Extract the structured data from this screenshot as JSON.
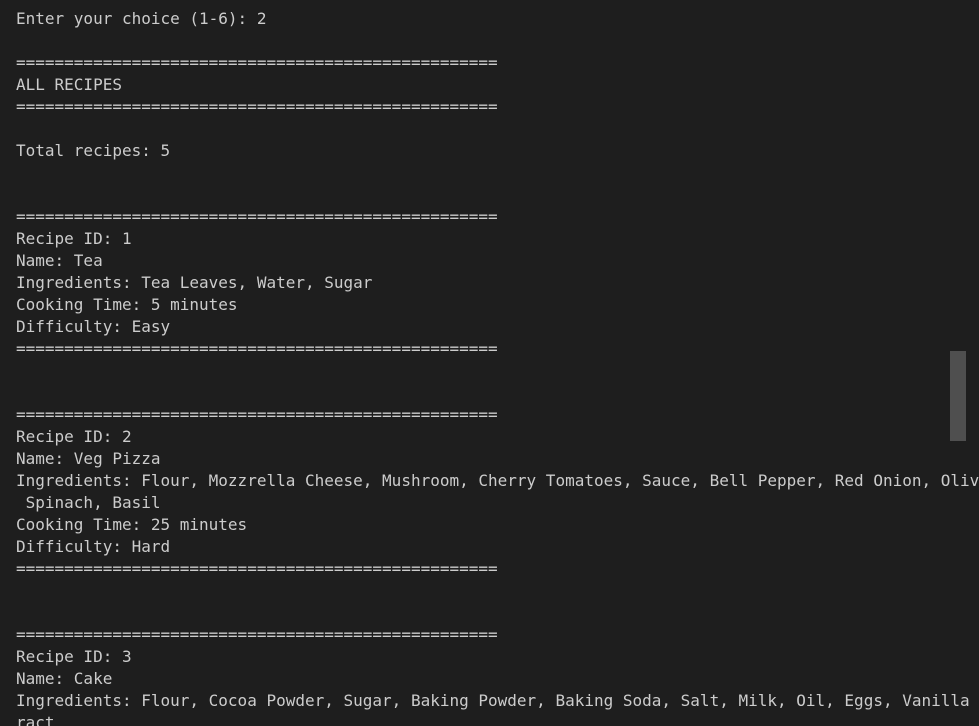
{
  "terminal": {
    "lines": [
      "Enter your choice (1-6): 2",
      "",
      "==================================================",
      "ALL RECIPES",
      "==================================================",
      "",
      "Total recipes: 5",
      "",
      "",
      "==================================================",
      "Recipe ID: 1",
      "Name: Tea",
      "Ingredients: Tea Leaves, Water, Sugar",
      "Cooking Time: 5 minutes",
      "Difficulty: Easy",
      "==================================================",
      "",
      "",
      "==================================================",
      "Recipe ID: 2",
      "Name: Veg Pizza",
      "Ingredients: Flour, Mozzrella Cheese, Mushroom, Cherry Tomatoes, Sauce, Bell Pepper, Red Onion, Olives,",
      " Spinach, Basil",
      "Cooking Time: 25 minutes",
      "Difficulty: Hard",
      "==================================================",
      "",
      "",
      "==================================================",
      "Recipe ID: 3",
      "Name: Cake",
      "Ingredients: Flour, Cocoa Powder, Sugar, Baking Powder, Baking Soda, Salt, Milk, Oil, Eggs, Vanilla Ext",
      "ract"
    ]
  }
}
